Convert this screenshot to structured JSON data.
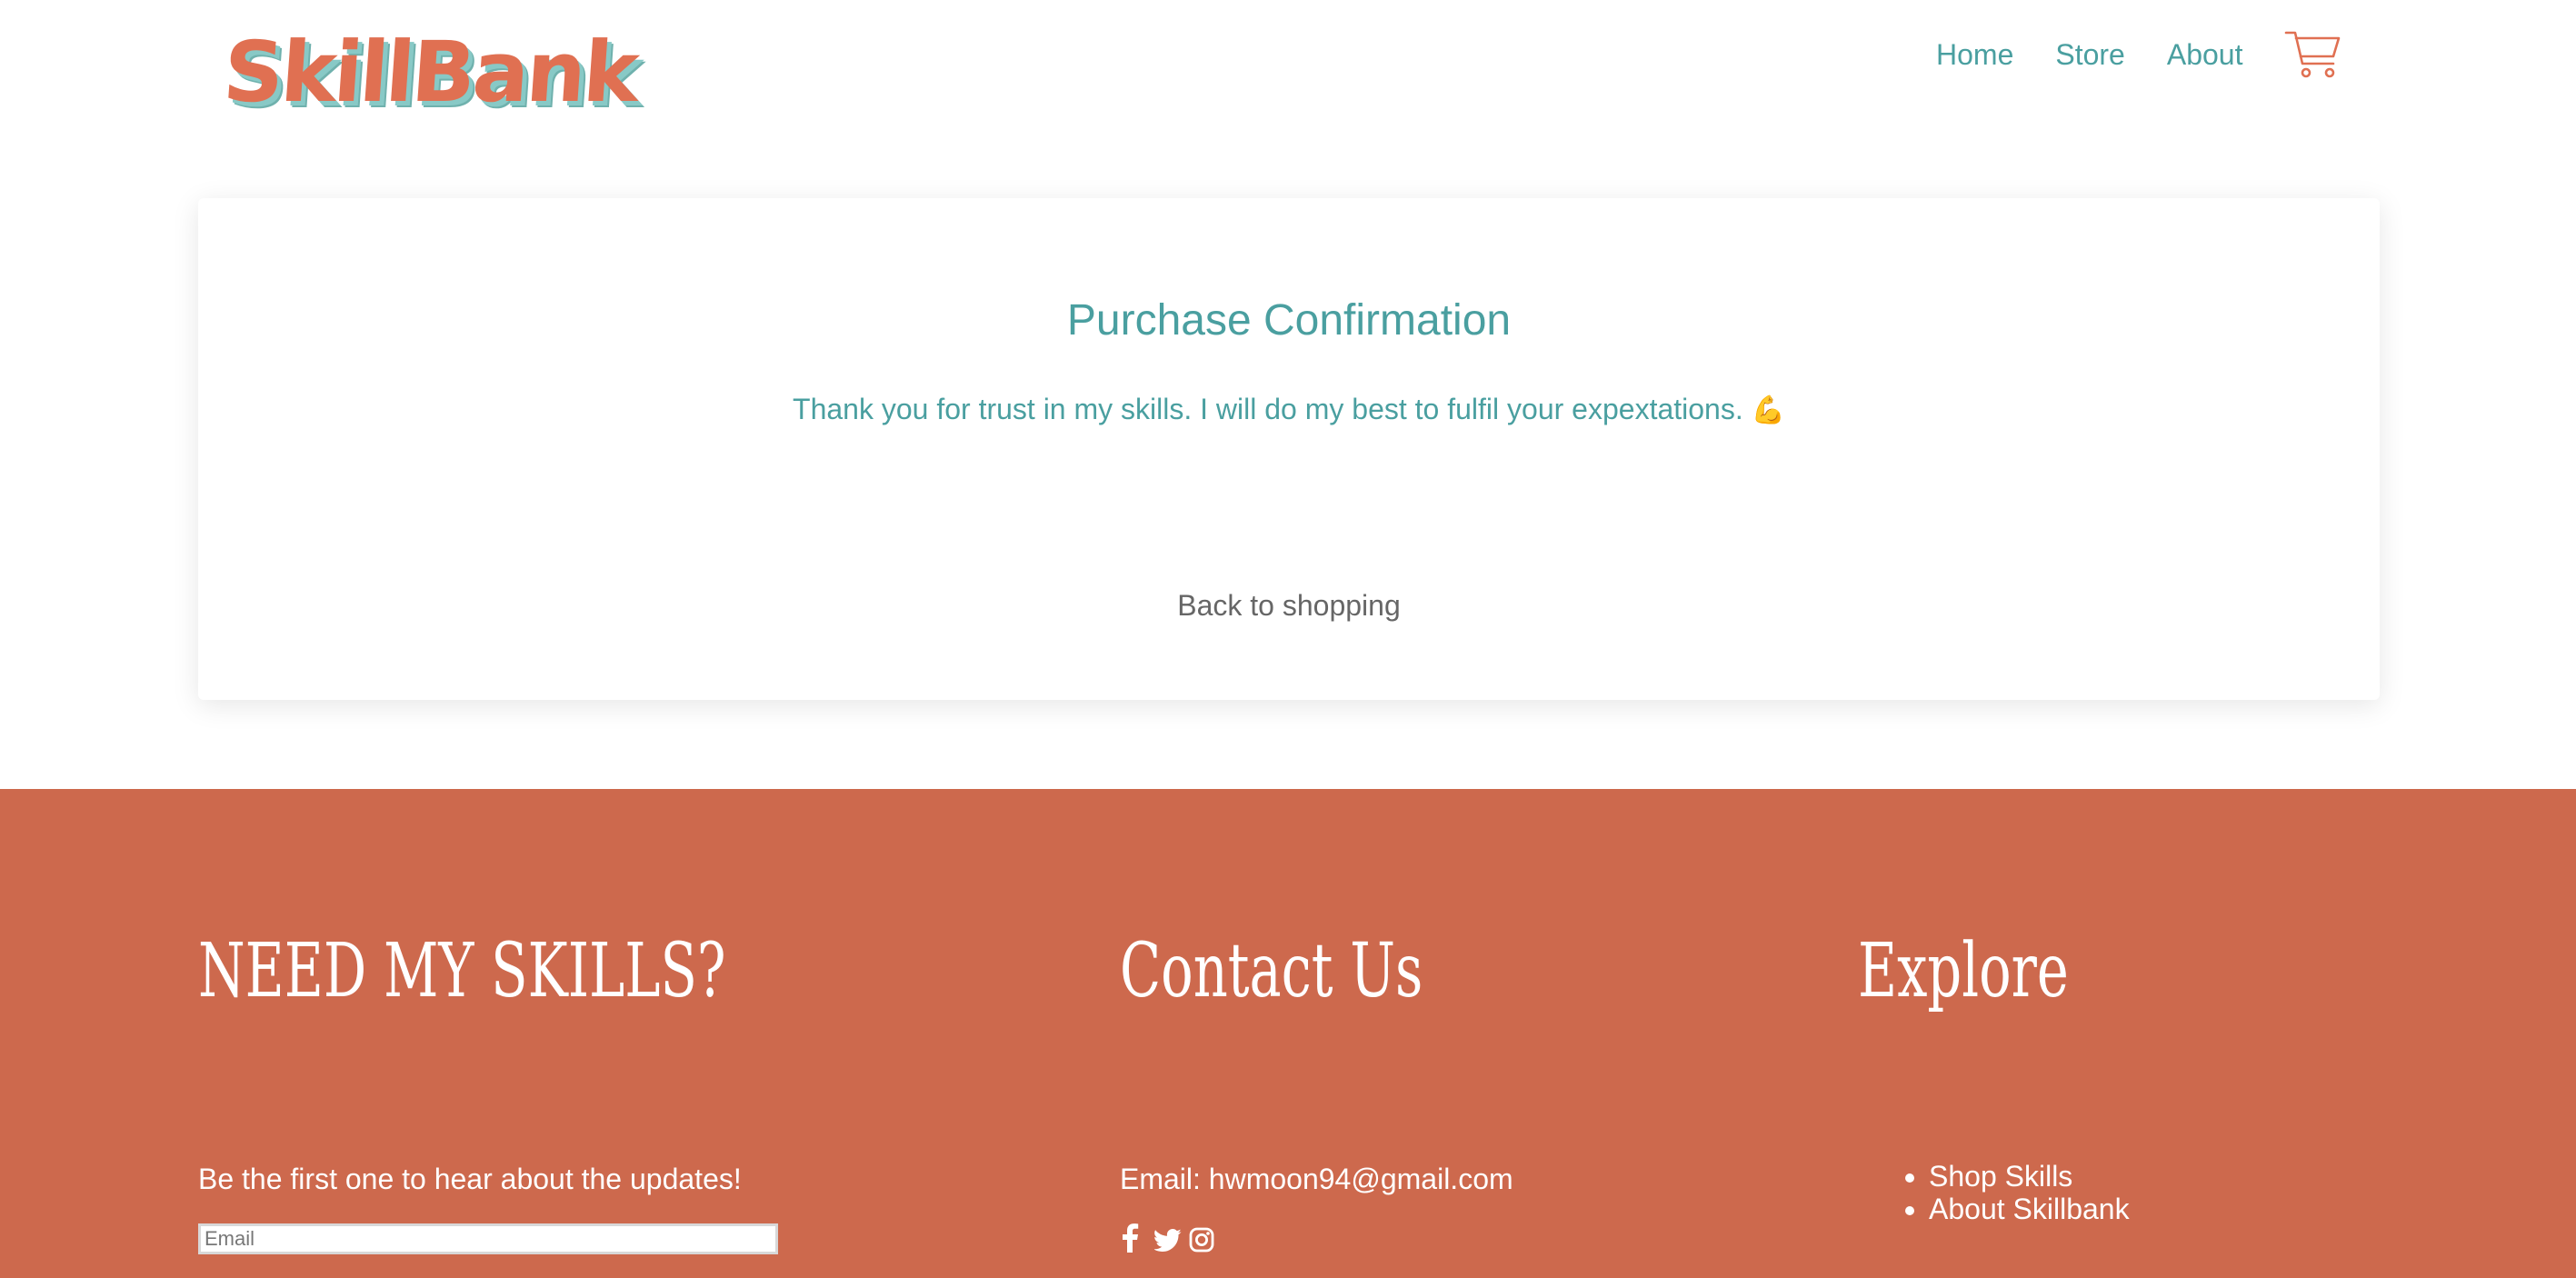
{
  "header": {
    "logo_text": "SkillBank",
    "nav": {
      "home": "Home",
      "store": "Store",
      "about": "About"
    },
    "cart_icon": "shopping-cart-icon"
  },
  "confirmation": {
    "title": "Purchase Confirmation",
    "message": "Thank you for trust in my skills. I will do my best to fulfil your expextations.",
    "emoji": "💪",
    "back_link": "Back to shopping"
  },
  "footer": {
    "newsletter": {
      "heading": "NEED MY SKILLS?",
      "text": "Be the first one to hear about the updates!",
      "email_placeholder": "Email"
    },
    "contact": {
      "heading": "Contact Us",
      "email_line": "Email: hwmoon94@gmail.com",
      "social_icons": [
        "facebook-icon",
        "twitter-icon",
        "instagram-icon"
      ]
    },
    "explore": {
      "heading": "Explore",
      "links": [
        "Shop Skills",
        "About Skillbank"
      ]
    }
  },
  "colors": {
    "accent_teal": "#4a9fa0",
    "brand_orange": "#e07052",
    "footer_bg": "#cd694d",
    "muted_text": "#666666"
  }
}
